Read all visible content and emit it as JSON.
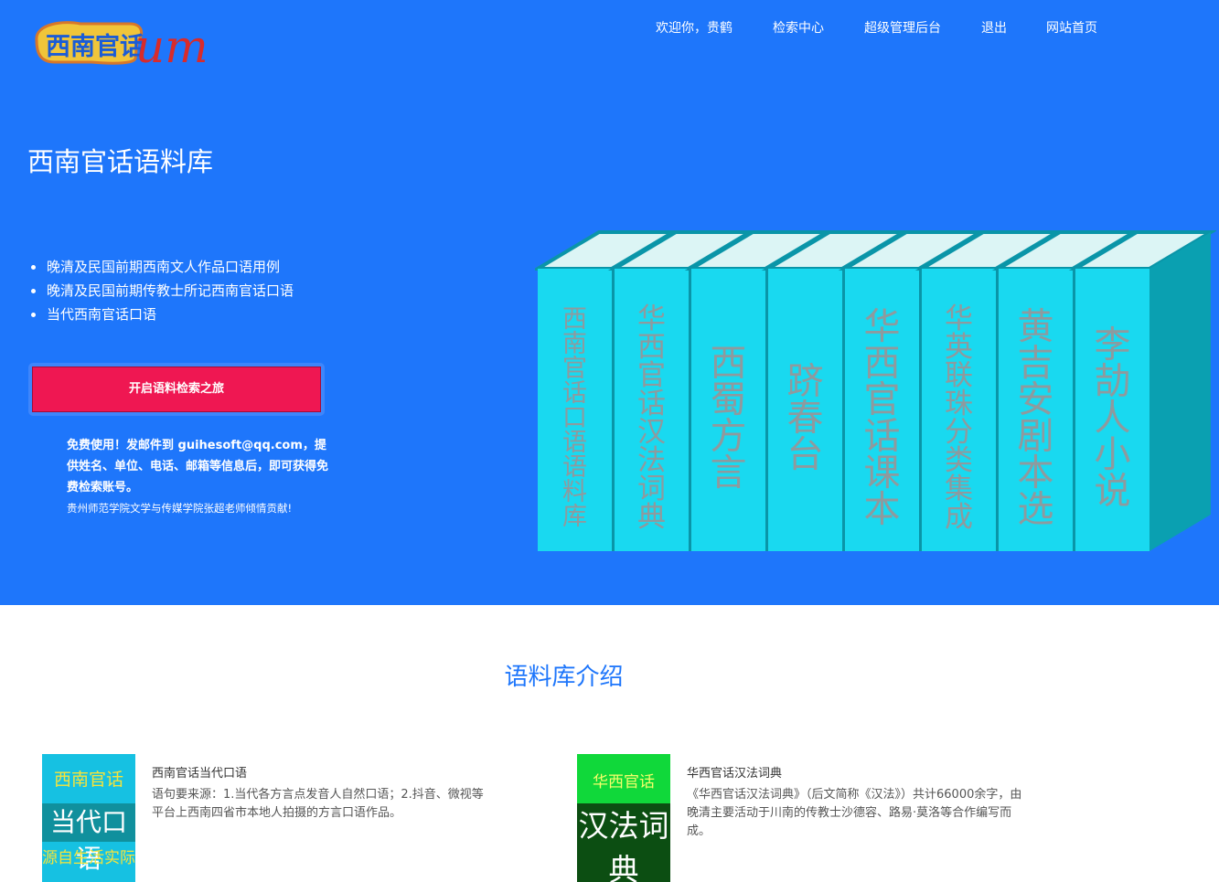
{
  "logo": {
    "text_cn": "西南官话",
    "text_latin": "um",
    "colors": {
      "fill": "#f0c53a",
      "outline": "#d7772a",
      "accent": "#d82b2b"
    }
  },
  "nav": {
    "items": [
      {
        "label": "欢迎你，贵鹤"
      },
      {
        "label": "检索中心"
      },
      {
        "label": "超级管理后台"
      },
      {
        "label": "退出"
      },
      {
        "label": "网站首页"
      }
    ]
  },
  "hero": {
    "title": "西南官话语料库",
    "bullets": [
      "晚清及民国前期西南文人作品口语用例",
      "晚清及民国前期传教士所记西南官话口语",
      "当代西南官话口语"
    ],
    "cta_label": "开启语料检索之旅",
    "free_text": "免费使用！发邮件到 guihesoft@qq.com，提供姓名、单位、电话、邮箱等信息后，即可获得免费检索账号。",
    "credit": "贵州师范学院文学与传媒学院张超老师倾情贡献!",
    "colors": {
      "background": "#1e76fb",
      "cta": "#ef1752"
    }
  },
  "books": [
    {
      "title": "西南官话口语语料库"
    },
    {
      "title": "华西官话汉法词典"
    },
    {
      "title": "西蜀方言"
    },
    {
      "title": "跻春台"
    },
    {
      "title": "华西官话课本"
    },
    {
      "title": "华英联珠分类集成"
    },
    {
      "title": "黄吉安剧本选"
    },
    {
      "title": "李劼人小说"
    }
  ],
  "book_colors": {
    "spine": "#19d9f0",
    "top": "#dcf5f5",
    "side": "#0aa0b1",
    "gap": "#0a95a8"
  },
  "intro": {
    "title": "语料库介绍",
    "cards": [
      {
        "thumb_lines": [
          "西南官话",
          "当代口语",
          "源自生活实际"
        ],
        "title": "西南官话当代口语",
        "desc": "语句要来源：1.当代各方言点发音人自然口语；2.抖音、微视等平台上西南四省市本地人拍摄的方言口语作品。"
      },
      {
        "thumb_lines": [
          "华西官话",
          "汉法词典"
        ],
        "title": "华西官话汉法词典",
        "desc": "《华西官话汉法词典》（后文简称《汉法》）共计66000余字，由晚清主要活动于川南的传教士沙德容、路易·莫洛等合作编写而成。"
      }
    ]
  }
}
